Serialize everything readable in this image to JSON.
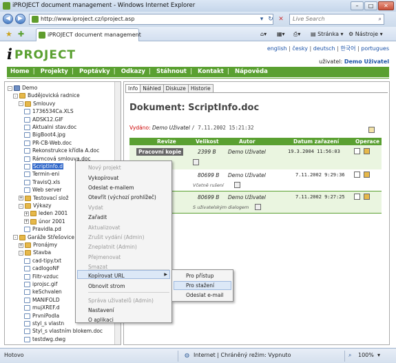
{
  "browser": {
    "title": "iPROJECT document management - Windows Internet Explorer",
    "address": "http://www.iproject.cz/iproject.asp",
    "search_placeholder": "Live Search",
    "tab_label": "iPROJECT document management",
    "toolbar": {
      "page": "Stránka",
      "tools": "Nástroje"
    }
  },
  "header": {
    "logo_i": "i",
    "logo_text": "PROJECT",
    "languages": [
      "english",
      "česky",
      "deutsch",
      "한국어",
      "portugues"
    ],
    "user_label": "uživatel:",
    "user_name": "Demo Uživatel"
  },
  "menu": [
    "Home",
    "Projekty",
    "Poptávky",
    "Odkazy",
    "Stáhnout",
    "Kontakt",
    "Nápověda"
  ],
  "tree": [
    {
      "label": "Demo",
      "icon": "computer-icon"
    },
    {
      "label": "Budějovická radnice",
      "icon": "folder-icon"
    },
    {
      "label": "Smlouvy",
      "icon": "folder-icon"
    },
    {
      "label": "1736534Ca.XLS",
      "icon": "document-icon"
    },
    {
      "label": "ADSK12.GIF",
      "icon": "document-icon"
    },
    {
      "label": "Aktualni stav.doc",
      "icon": "document-icon"
    },
    {
      "label": "BigBoot4.jpg",
      "icon": "document-icon"
    },
    {
      "label": "PR-CB-Web.doc",
      "icon": "document-icon"
    },
    {
      "label": "Rekonstrukce křídla A.doc",
      "icon": "document-icon"
    },
    {
      "label": "Rámcová smlouva.doc",
      "icon": "document-icon"
    },
    {
      "label": "ScriptInfo.d",
      "icon": "document-icon",
      "selected": true
    },
    {
      "label": "Termin-eni",
      "icon": "document-icon"
    },
    {
      "label": "TravisQ.xls",
      "icon": "document-icon"
    },
    {
      "label": "Web server",
      "icon": "document-icon"
    },
    {
      "label": "Testovací slož",
      "icon": "folder-icon"
    },
    {
      "label": "Výkazy",
      "icon": "folder-icon"
    },
    {
      "label": "leden 2001",
      "icon": "folder-icon"
    },
    {
      "label": "únor 2001",
      "icon": "folder-icon"
    },
    {
      "label": "Pravidla.pd",
      "icon": "document-icon"
    },
    {
      "label": "Garáže Střešovice",
      "icon": "folder-icon"
    },
    {
      "label": "Pronájmy",
      "icon": "folder-icon"
    },
    {
      "label": "Stavba",
      "icon": "folder-icon"
    },
    {
      "label": "cad-tipy.txt",
      "icon": "document-icon"
    },
    {
      "label": "cadlogoNF",
      "icon": "document-icon"
    },
    {
      "label": "Filtr-vzduc",
      "icon": "document-icon"
    },
    {
      "label": "iprojsc.gif",
      "icon": "document-icon"
    },
    {
      "label": "keSchvalen",
      "icon": "document-icon"
    },
    {
      "label": "MANIFOLD",
      "icon": "document-icon"
    },
    {
      "label": "mujXREF.d",
      "icon": "document-icon"
    },
    {
      "label": "PrvniPodla",
      "icon": "document-icon"
    },
    {
      "label": "styl_s vlastn",
      "icon": "document-icon"
    },
    {
      "label": "Styl_s vlastním blokem.doc",
      "icon": "document-icon"
    },
    {
      "label": "testdwg.dwg",
      "icon": "document-icon"
    }
  ],
  "tabs": [
    "Info",
    "Náhled",
    "Diskuze",
    "Historie"
  ],
  "document": {
    "title": "Dokument: ScriptInfo.doc",
    "issued_label": "Vydáno:",
    "issued_by": "Demo Uživatel",
    "issued_date": "/ 7.11.2002 15:21:32"
  },
  "table": {
    "headers": [
      "Revize",
      "Velikost",
      "Autor",
      "Datum zařazení",
      "Operace"
    ],
    "rows": [
      {
        "revision": "Pracovní kopie",
        "size": "2399 B",
        "author": "Demo Uživatel",
        "date": "19.3.2004 11:56:03",
        "note": ""
      },
      {
        "revision": "",
        "size": "80699 B",
        "author": "Demo Uživatel",
        "date": "7.11.2002 9:29:36",
        "note": "Včetně rušení"
      },
      {
        "revision": "",
        "size": "80699 B",
        "author": "Demo Uživatel",
        "date": "7.11.2002 9:27:25",
        "note": "S uživatelským dialogem"
      }
    ]
  },
  "context_menu": [
    {
      "label": "Nový projekt",
      "disabled": true
    },
    {
      "label": "Vykopírovat",
      "disabled": false
    },
    {
      "label": "Odeslat e-mailem",
      "disabled": false
    },
    {
      "label": "Otevřít (výchozí prohlížeč)",
      "disabled": false
    },
    {
      "label": "Vydat",
      "disabled": true
    },
    {
      "label": "Zařadit",
      "disabled": false
    },
    {
      "label": "Aktualizovat",
      "disabled": true
    },
    {
      "label": "Zrušit vydání (Admin)",
      "disabled": true
    },
    {
      "label": "Zneplatnit (Admin)",
      "disabled": true
    },
    {
      "label": "Přejmenovat",
      "disabled": true
    },
    {
      "label": "Smazat",
      "disabled": true
    },
    {
      "label": "Kopírovat URL",
      "disabled": false
    },
    {
      "label": "Obnovit strom",
      "disabled": false
    },
    {
      "label": "Správa uživatelů (Admin)",
      "disabled": true
    },
    {
      "label": "Nastavení",
      "disabled": false
    },
    {
      "label": "O aplikaci",
      "disabled": false
    }
  ],
  "submenu": [
    "Pro přístup",
    "Pro stažení",
    "Odeslat e-mail"
  ],
  "status": {
    "left": "Hotovo",
    "zone": "Internet | Chráněný režim: Vypnuto",
    "zoom": "100%"
  }
}
